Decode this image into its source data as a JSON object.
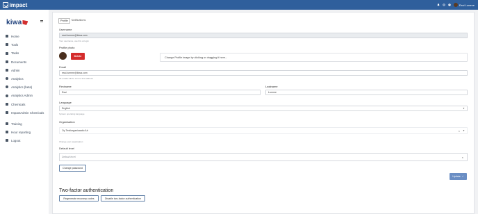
{
  "app": {
    "title": "impact"
  },
  "header": {
    "user_name": "Essi Lumme"
  },
  "sidebar": {
    "logo_text": "kiwa",
    "items": [
      {
        "label": "Home",
        "icon": "home-icon"
      },
      {
        "label": "Tools",
        "icon": "tools-icon"
      },
      {
        "label": "Tasks",
        "icon": "tasks-icon"
      },
      {
        "label": "Documents",
        "icon": "folder-icon"
      },
      {
        "label": "Admin",
        "icon": "admin-icon"
      },
      {
        "label": "Analytics",
        "icon": "analytics-icon"
      },
      {
        "label": "Analytics (beta)",
        "icon": "analytics-icon"
      },
      {
        "label": "Analytics Admin",
        "icon": "analytics-icon"
      },
      {
        "label": "Chemicals",
        "icon": "flask-icon"
      },
      {
        "label": "ImpactAdmin Chemicals",
        "icon": "flask-icon"
      },
      {
        "label": "Training",
        "icon": "training-icon"
      },
      {
        "label": "Hour reporting",
        "icon": "clock-icon"
      },
      {
        "label": "Logout",
        "icon": "logout-icon"
      }
    ]
  },
  "tabs": [
    {
      "label": "Profile",
      "active": true
    },
    {
      "label": "Notifications",
      "active": false
    }
  ],
  "form": {
    "username_label": "Username",
    "username_value": "essi.lumme@kiwa.com",
    "username_help": "Your username, use this at login",
    "photo_label": "Profile photo",
    "delete_label": "Delete",
    "dropzone_text": "Change Profile image by clicking or dragging it here...",
    "email_label": "Email",
    "email_value": "essi.lumme@kiwa.com",
    "email_help": "All emails will be sent to this address",
    "firstname_label": "Firstname",
    "firstname_value": "Essi",
    "lastname_label": "Lastname",
    "lastname_value": "Lumme",
    "language_label": "Language",
    "language_value": "English",
    "language_help": "System operating language",
    "organisation_label": "Organisation",
    "organisation_value": "Oy Testiorganisaatio Ab",
    "organisation_help": "Change your organisation",
    "default_level_label": "Default level",
    "default_level_placeholder": "Default level",
    "change_password_label": "Change password",
    "update_label": "Update",
    "twofa_heading": "Two-factor authentication",
    "regenerate_label": "Regenerate recovery codes",
    "disable_2fa_label": "Disable two-factor authentication"
  },
  "colors": {
    "topbar": "#2f5f9c",
    "delete_button": "#d42b2b",
    "update_button": "#6a8ec4"
  }
}
